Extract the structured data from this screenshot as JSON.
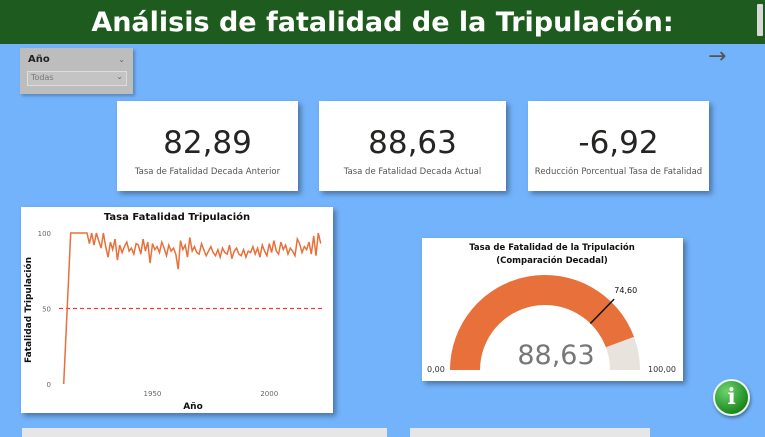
{
  "header": {
    "title": "Análisis de fatalidad de la Tripulación:"
  },
  "slicer": {
    "label": "Año",
    "value": "Todas"
  },
  "cards": [
    {
      "value": "82,89",
      "caption": "Tasa de Fatalidad Decada Anterior"
    },
    {
      "value": "88,63",
      "caption": "Tasa de Fatalidad Decada Actual"
    },
    {
      "value": "-6,92",
      "caption": "Reducción Porcentual Tasa de Fatalidad"
    }
  ],
  "line_chart": {
    "title": "Tasa Fatalidad Tripulación",
    "xlabel": "Año",
    "ylabel": "Fatalidad Tripulación"
  },
  "gauge": {
    "title_line1": "Tasa de Fatalidad de la Tripulación",
    "title_line2": "(Comparación Decadal)",
    "value_label": "88,63",
    "min_label": "0,00",
    "max_label": "100,00",
    "target_label": "74,60"
  },
  "info_button": {
    "glyph": "i"
  },
  "colors": {
    "accent": "#e8703a",
    "banner": "#1e5b1e",
    "background": "#73b3fb",
    "reference_line": "#e8413a"
  },
  "chart_data": [
    {
      "type": "line",
      "title": "Tasa Fatalidad Tripulación",
      "xlabel": "Año",
      "ylabel": "Fatalidad Tripulación",
      "xlim": [
        1910,
        2023
      ],
      "ylim": [
        0,
        100
      ],
      "x_ticks": [
        1950,
        2000
      ],
      "y_ticks": [
        0,
        50,
        100
      ],
      "reference_line": {
        "y": 50,
        "style": "dashed"
      },
      "x": [
        1912,
        1915,
        1916,
        1917,
        1918,
        1919,
        1920,
        1921,
        1922,
        1923,
        1924,
        1925,
        1926,
        1927,
        1928,
        1929,
        1930,
        1931,
        1932,
        1933,
        1934,
        1935,
        1936,
        1937,
        1938,
        1939,
        1940,
        1941,
        1942,
        1943,
        1944,
        1945,
        1946,
        1947,
        1948,
        1949,
        1950,
        1951,
        1952,
        1953,
        1954,
        1955,
        1956,
        1957,
        1958,
        1959,
        1960,
        1961,
        1962,
        1963,
        1964,
        1965,
        1966,
        1967,
        1968,
        1969,
        1970,
        1971,
        1972,
        1973,
        1974,
        1975,
        1976,
        1977,
        1978,
        1979,
        1980,
        1981,
        1982,
        1983,
        1984,
        1985,
        1986,
        1987,
        1988,
        1989,
        1990,
        1991,
        1992,
        1993,
        1994,
        1995,
        1996,
        1997,
        1998,
        1999,
        2000,
        2001,
        2002,
        2003,
        2004,
        2005,
        2006,
        2007,
        2008,
        2009,
        2010,
        2011,
        2012,
        2013,
        2014,
        2015,
        2016,
        2017,
        2018,
        2019,
        2020,
        2021,
        2022
      ],
      "y": [
        0,
        100,
        100,
        100,
        100,
        100,
        100,
        100,
        100,
        93,
        100,
        92,
        100,
        95,
        90,
        100,
        91,
        84,
        94,
        89,
        96,
        82,
        92,
        87,
        91,
        94,
        88,
        90,
        86,
        93,
        92,
        86,
        96,
        88,
        94,
        80,
        93,
        89,
        91,
        87,
        94,
        90,
        85,
        92,
        88,
        90,
        86,
        76,
        95,
        89,
        92,
        84,
        97,
        88,
        91,
        87,
        86,
        93,
        89,
        85,
        88,
        91,
        87,
        85,
        89,
        84,
        90,
        87,
        86,
        92,
        83,
        88,
        90,
        86,
        85,
        89,
        84,
        88,
        87,
        91,
        86,
        90,
        84,
        92,
        88,
        85,
        93,
        87,
        95,
        88,
        86,
        94,
        89,
        92,
        86,
        90,
        88,
        85,
        96,
        93,
        87,
        91,
        89,
        94,
        86,
        98,
        85,
        100,
        93
      ]
    },
    {
      "type": "gauge",
      "title": "Tasa de Fatalidad de la Tripulación (Comparación Decadal)",
      "value": 88.63,
      "min": 0,
      "max": 100,
      "target": 74.6
    }
  ]
}
